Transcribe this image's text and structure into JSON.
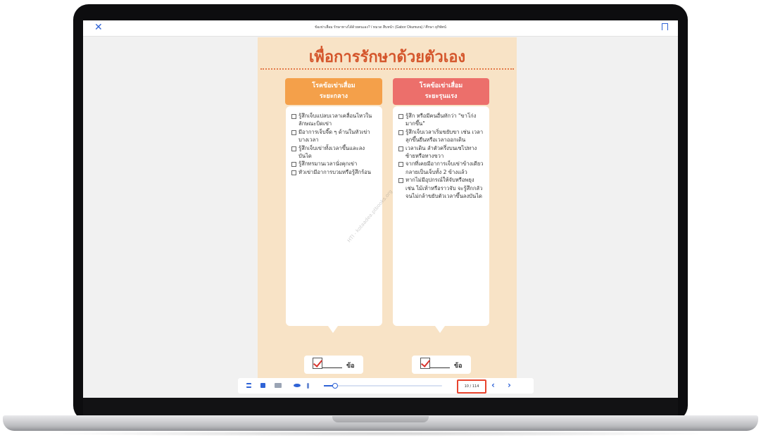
{
  "topbar": {
    "doc_title": "ข้อเข่าเสื่อม รักษาทางได้ด้วยตนเอง? / หมวด สืบหน้า (Gabor Okumura) / ศึกษา ยุกิทัศน์",
    "close_icon": "✕"
  },
  "page": {
    "title": "เพื่อการรักษาด้วยตัวเอง",
    "watermark": "HTI - kotaadea.ptbooks.org"
  },
  "columns": {
    "left": {
      "header": [
        "โรคข้อเข่าเสื่อม",
        "ระยะกลาง"
      ],
      "items": [
        "รู้สึกเจ็บแปลบเวลาเคลื่อนไหวในลักษณะบิดเข่า",
        "มีอาการเจ็บจี๊ด ๆ ด้านในหัวเข่าบางเวลา",
        "รู้สึกเจ็บเข่าทั้งเวลาขึ้นและลงบันได",
        "รู้สึกทรมานเวลานั่งคุกเข่า",
        "หัวเข่ามีอาการบวมหรือรู้สึกร้อน"
      ],
      "count_unit": "ข้อ"
    },
    "right": {
      "header": [
        "โรคข้อเข่าเสื่อม",
        "ระยะรุนแรง"
      ],
      "items": [
        "รู้สึก หรือมีคนอื่นทักว่า \"ขาโก่งมากขึ้น\"",
        "รู้สึกเจ็บเวลาเริ่มขยับขา เช่น เวลาลุกขึ้นยืนหรือเวลาออกเดิน",
        "เวลาเดิน ลำตัวครึ่งบนเซไปทางซ้ายหรือทางขวา",
        "จากที่เคยมีอาการเจ็บเข่าข้างเดียวกลายเป็นเจ็บทั้ง 2 ข้างแล้ว",
        "หากไม่มีอุปกรณ์ให้จับหรือพยุง เช่น ไม้เท้าหรือราวจับ จะรู้สึกกลัวจนไม่กล้าขยับตัวเวลาขึ้นลงบันได"
      ],
      "count_unit": "ข้อ"
    }
  },
  "toolbar": {
    "page_indicator": "10 / 114",
    "progress": 0.087,
    "prev_icon": "‹",
    "next_icon": "›",
    "icons": [
      "list-icon",
      "document-icon",
      "image-icon",
      "eye-icon",
      "microphone-icon"
    ]
  },
  "colors": {
    "accent": "#2f63d6",
    "page_bg": "#f8e3c6",
    "title": "#d4552b",
    "header_mid": "#f4a04a",
    "header_severe": "#ec6f6b",
    "highlight": "#e8442e"
  }
}
